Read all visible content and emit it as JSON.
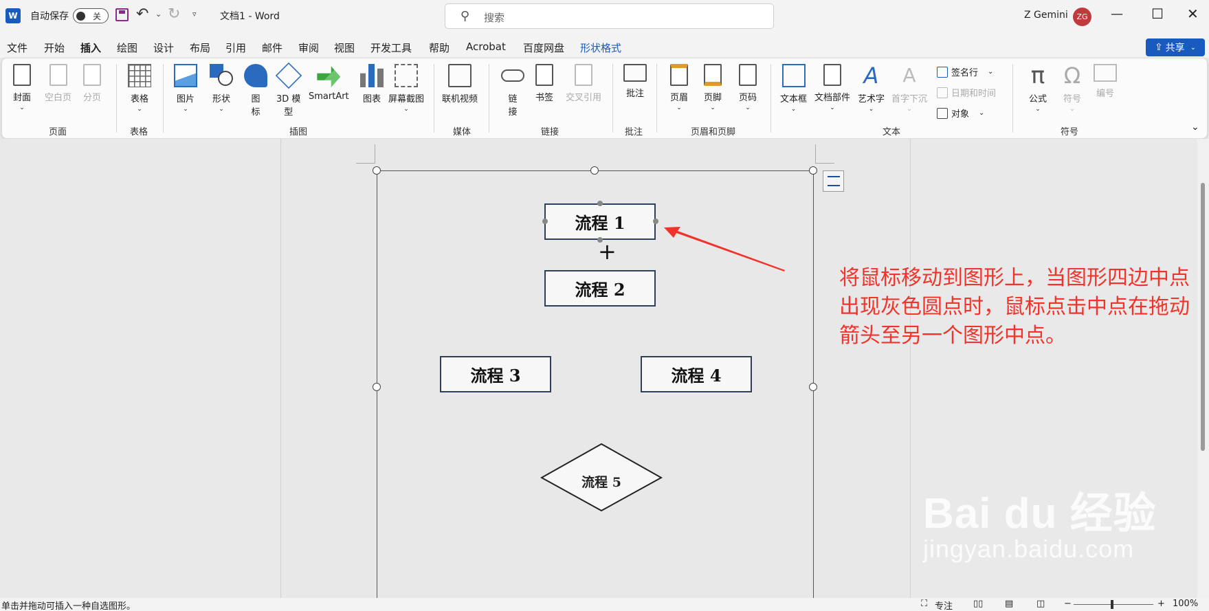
{
  "titlebar": {
    "app_logo": "W",
    "autosave_label": "自动保存",
    "autosave_state": "关",
    "doc_title": "文档1 - Word",
    "search_placeholder": "搜索",
    "user_name": "Z Gemini",
    "user_initials": "ZG",
    "icons": [
      "save-icon",
      "undo-icon",
      "redo-icon",
      "search-icon",
      "minimize-icon",
      "maximize-icon",
      "close-icon"
    ]
  },
  "tabs": [
    {
      "label": "文件"
    },
    {
      "label": "开始"
    },
    {
      "label": "插入"
    },
    {
      "label": "绘图"
    },
    {
      "label": "设计"
    },
    {
      "label": "布局"
    },
    {
      "label": "引用"
    },
    {
      "label": "邮件"
    },
    {
      "label": "审阅"
    },
    {
      "label": "视图"
    },
    {
      "label": "开发工具"
    },
    {
      "label": "帮助"
    },
    {
      "label": "Acrobat"
    },
    {
      "label": "百度网盘"
    },
    {
      "label": "形状格式"
    }
  ],
  "active_tab": "插入",
  "share_label": "共享",
  "ribbon": {
    "cover": "封面",
    "blank_page": "空白页",
    "page_break": "分页",
    "group_pages": "页面",
    "table": "表格",
    "group_table": "表格",
    "pictures": "图片",
    "shapes": "形状",
    "icons_l1": "图",
    "icons_l2": "标",
    "model3d_l1": "3D 模",
    "model3d_l2": "型",
    "smartart": "SmartArt",
    "chart": "图表",
    "screenshot": "屏幕截图",
    "group_illustrations": "插图",
    "online_video": "联机视频",
    "group_media": "媒体",
    "link_l1": "链",
    "link_l2": "接",
    "bookmark": "书签",
    "cross_ref": "交叉引用",
    "group_links": "链接",
    "comment": "批注",
    "group_comments": "批注",
    "header": "页眉",
    "footer": "页脚",
    "page_number": "页码",
    "group_header_footer": "页眉和页脚",
    "text_box": "文本框",
    "quick_parts": "文档部件",
    "wordart": "艺术字",
    "drop_cap": "首字下沉",
    "signature_line": "签名行",
    "date_time": "日期和时间",
    "object": "对象",
    "group_text": "文本",
    "equation": "公式",
    "symbol": "符号",
    "numbering": "编号",
    "group_symbols": "符号"
  },
  "document": {
    "shapes": [
      {
        "label": "流程 1"
      },
      {
        "label": "流程 2"
      },
      {
        "label": "流程 3"
      },
      {
        "label": "流程 4"
      },
      {
        "label": "流程 5"
      }
    ],
    "annotation": "将鼠标移动到图形上，当图形四边中点出现灰色圆点时，鼠标点击中点在拖动箭头至另一个图形中点。",
    "annotation_color": "#f1342b",
    "watermark_main": "Bai du 经验",
    "watermark_sub": "jingyan.baidu.com"
  },
  "statusbar": {
    "hint": "单击并拖动可插入一种自选图形。",
    "focus": "专注",
    "zoom_minus": "−",
    "zoom_plus": "+",
    "zoom_level": "100%"
  },
  "colors": {
    "accent": "#185abd",
    "avatar": "#c0393b",
    "shape_border": "#2f3f5a"
  }
}
